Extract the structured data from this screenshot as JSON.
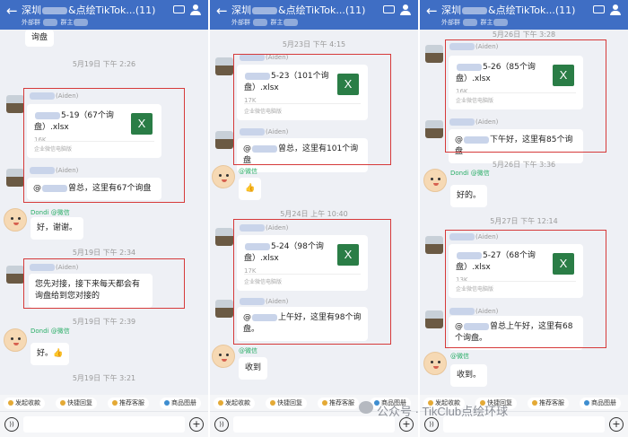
{
  "chat_title": "深圳 ____ &点绘TikTok...(11)",
  "chat_title_short": "深圳",
  "header_title_suffix": "&点绘TikTok...(11)",
  "header_title_suffix_mid": "&点绘TikTok...(11)",
  "header_subtitle": "外部群",
  "header_subtitle_2": "群主",
  "sender_aiden": "(Aiden)",
  "sender_wx": "@微信",
  "sender_dondi": "Dondi",
  "file_source": "企业微信电脑版",
  "toolbar": {
    "chip1": "发起收款",
    "chip2": "快捷回复",
    "chip3": "推荐客服",
    "chip4": "商品图册"
  },
  "panels": [
    {
      "times": [
        "5月19日 下午 2:26",
        "5月19日 下午 2:34",
        "5月19日 下午 2:39",
        "5月19日 下午 3:21"
      ],
      "top_msg": "询盘",
      "file": {
        "name": "5-19（67个询盘）.xlsx",
        "size": "16K",
        "icon": "X"
      },
      "msg1": "曾总，这里有67个询盘",
      "reply1": "好，谢谢。",
      "msg2": "您先对接，接下来每天都会有询盘给到您对接的",
      "reply2": "好。👍"
    },
    {
      "times": [
        "5月23日 下午 4:15",
        "5月24日 上午 10:40"
      ],
      "file": {
        "name": "5-23（101个询盘）.xlsx",
        "size": "17K",
        "icon": "X"
      },
      "msg1": "曾总，这里有101个询盘",
      "reply1": "👍",
      "file2": {
        "name": "5-24（98个询盘）.xlsx",
        "size": "17K",
        "icon": "X"
      },
      "msg2": "上午好，这里有98个询盘。",
      "reply2": "收到"
    },
    {
      "times": [
        "5月26日 下午 3:28",
        "5月26日 下午 3:36",
        "5月27日 下午 12:14"
      ],
      "file": {
        "name": "5-26（85个询盘）.xlsx",
        "size": "16K",
        "icon": "X"
      },
      "msg1": "下午好，这里有85个询盘",
      "reply1": "好的。",
      "file2": {
        "name": "5-27（68个询盘）.xlsx",
        "size": "13K",
        "icon": "X"
      },
      "msg2": "曾总上午好，这里有68个询盘。",
      "reply2": "收到。"
    }
  ],
  "watermark": "公众号 · TikClub点绘环球",
  "colors": {
    "header": "#3f6ec4",
    "highlight": "#d63a3a",
    "excel": "#2a7d46",
    "wechat_green": "#2aae67"
  }
}
